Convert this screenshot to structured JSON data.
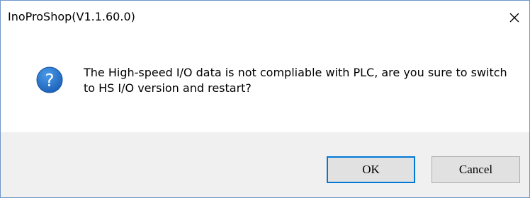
{
  "window": {
    "title": "InoProShop(V1.1.60.0)",
    "close_icon": "close-icon"
  },
  "message": {
    "icon": "question-icon",
    "icon_color": "#1f6fd0",
    "text": "The High-speed I/O data is not compliable with PLC, are you sure to switch to HS I/O version and restart?"
  },
  "buttons": {
    "ok_label": "OK",
    "cancel_label": "Cancel",
    "default_border_color": "#0078d7"
  }
}
